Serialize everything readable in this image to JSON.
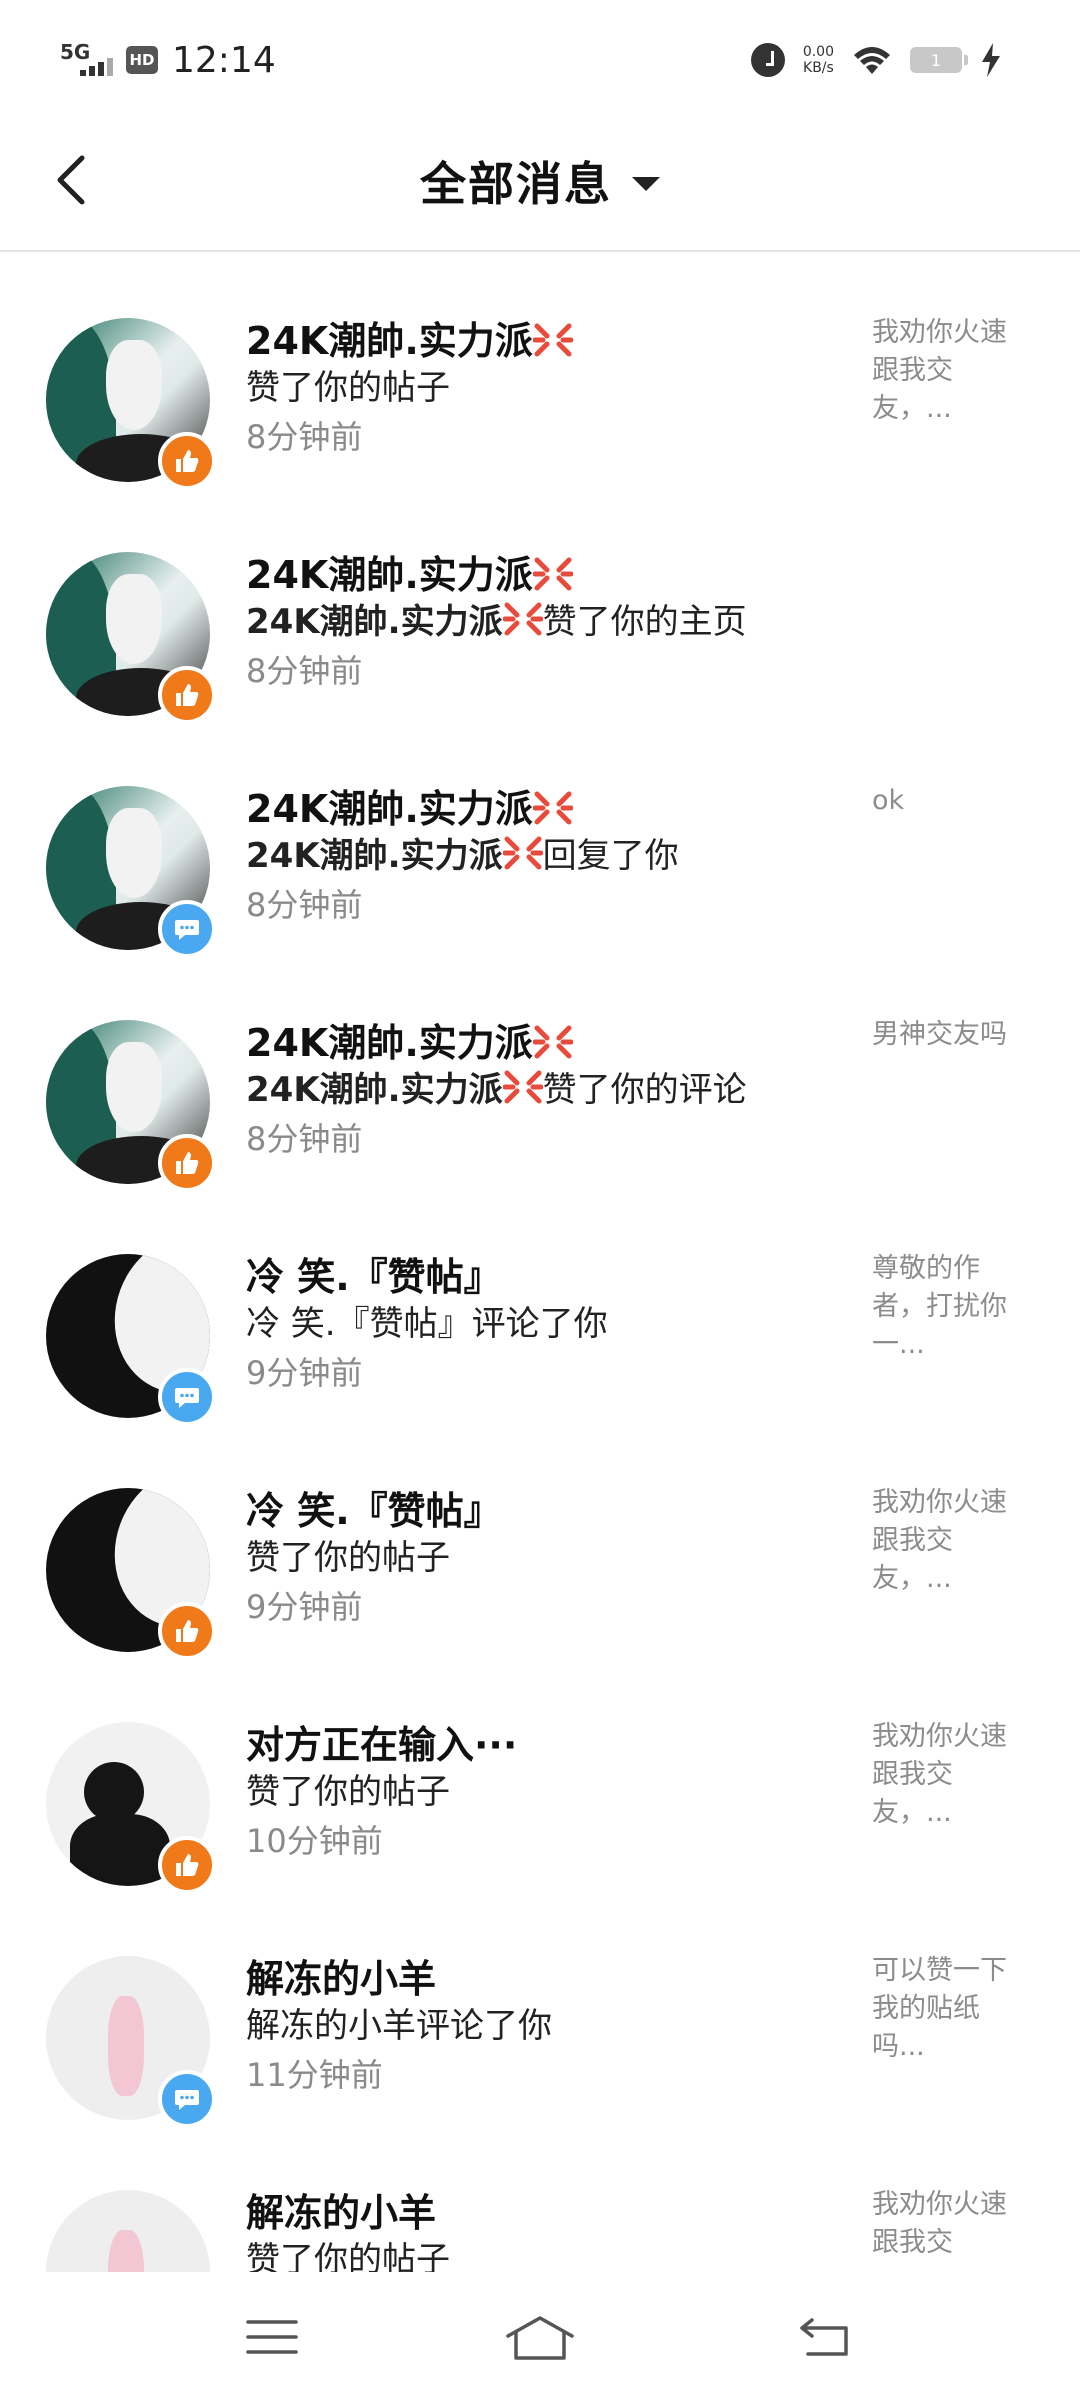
{
  "status_bar": {
    "network": "5G",
    "hd": "HD",
    "time": "12:14",
    "speed_value": "0.00",
    "speed_unit": "KB/s",
    "battery": "1",
    "icons": [
      "signal-icon",
      "hd-icon",
      "alarm-icon",
      "wifi-icon",
      "battery-icon",
      "charging-icon"
    ]
  },
  "header": {
    "title": "全部消息",
    "back_icon": "back-arrow-icon",
    "dropdown_icon": "caret-down-icon"
  },
  "messages": [
    {
      "name": "24K潮帥.实力派",
      "name_emoji": true,
      "avatar": "anime",
      "badge": "like",
      "action": "赞了你的帖子",
      "action_bold_prefix": "",
      "time": "8分钟前",
      "preview": "我劝你火速跟我交友，..."
    },
    {
      "name": "24K潮帥.实力派",
      "name_emoji": true,
      "avatar": "anime",
      "badge": "like",
      "action": "赞了你的主页",
      "action_bold_prefix": "24K潮帥.实力派",
      "time": "8分钟前",
      "preview": ""
    },
    {
      "name": "24K潮帥.实力派",
      "name_emoji": true,
      "avatar": "anime",
      "badge": "comment",
      "action": "回复了你",
      "action_bold_prefix": "24K潮帥.实力派",
      "time": "8分钟前",
      "preview": "ok"
    },
    {
      "name": "24K潮帥.实力派",
      "name_emoji": true,
      "avatar": "anime",
      "badge": "like",
      "action": "赞了你的评论",
      "action_bold_prefix": "24K潮帥.实力派",
      "time": "8分钟前",
      "preview": "男神交友吗"
    },
    {
      "name": "冷 笑.『赞帖』",
      "name_emoji": false,
      "avatar": "silhouette",
      "badge": "comment",
      "action": "冷 笑.『赞帖』评论了你",
      "action_bold_prefix": "",
      "time": "9分钟前",
      "preview": "尊敬的作者，打扰你一..."
    },
    {
      "name": "冷 笑.『赞帖』",
      "name_emoji": false,
      "avatar": "silhouette",
      "badge": "like",
      "action": "赞了你的帖子",
      "action_bold_prefix": "",
      "time": "9分钟前",
      "preview": "我劝你火速跟我交友，..."
    },
    {
      "name": "对方正在输入···",
      "name_emoji": false,
      "avatar": "girl",
      "badge": "like",
      "action": "赞了你的帖子",
      "action_bold_prefix": "",
      "time": "10分钟前",
      "preview": "我劝你火速跟我交友，..."
    },
    {
      "name": "解冻的小羊",
      "name_emoji": false,
      "avatar": "sheep",
      "badge": "comment",
      "action": "解冻的小羊评论了你",
      "action_bold_prefix": "",
      "time": "11分钟前",
      "preview": "可以赞一下我的贴纸吗..."
    },
    {
      "name": "解冻的小羊",
      "name_emoji": false,
      "avatar": "sheep",
      "badge": "like",
      "action": "赞了你的帖子",
      "action_bold_prefix": "",
      "time": "",
      "preview": "我劝你火速跟我交"
    }
  ],
  "nav_bar": {
    "icons": [
      "menu-icon",
      "home-icon",
      "back-icon"
    ]
  },
  "colors": {
    "like_badge": "#f07a1a",
    "comment_badge": "#4aa8f0",
    "time_gray": "#8a8a8a",
    "angry_emoji": "#e84b3c"
  }
}
